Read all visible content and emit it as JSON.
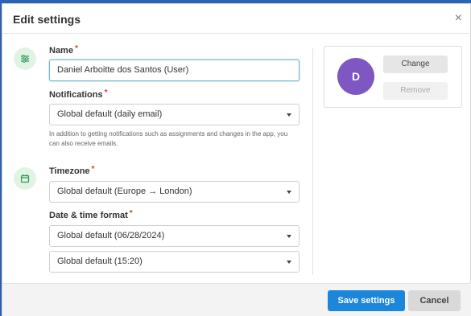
{
  "background_strip": {
    "text": "…"
  },
  "modal": {
    "title": "Edit settings",
    "close_glyph": "×"
  },
  "sections": {
    "profile": {
      "icon": "sliders-icon",
      "name_label": "Name",
      "name_value": "Daniel Arboitte dos Santos (User)",
      "notifications_label": "Notifications",
      "notifications_value": "Global default (daily email)",
      "notifications_help": "In addition to getting notifications such as assignments and changes in the app, you can also receive emails."
    },
    "time": {
      "icon": "calendar-icon",
      "timezone_label": "Timezone",
      "timezone_value": "Global default (Europe → London)",
      "datetime_label": "Date & time format",
      "date_value": "Global default (06/28/2024)",
      "time_value": "Global default (15:20)"
    }
  },
  "required_marker": "*",
  "avatar": {
    "initial": "D",
    "change_label": "Change",
    "remove_label": "Remove"
  },
  "footer": {
    "save_label": "Save settings",
    "cancel_label": "Cancel"
  },
  "colors": {
    "primary": "#1c86db",
    "avatar": "#7e57c2",
    "section_icon_bg": "#e1f3e3",
    "section_icon_fg": "#2e9b55",
    "required": "#e0392f"
  }
}
